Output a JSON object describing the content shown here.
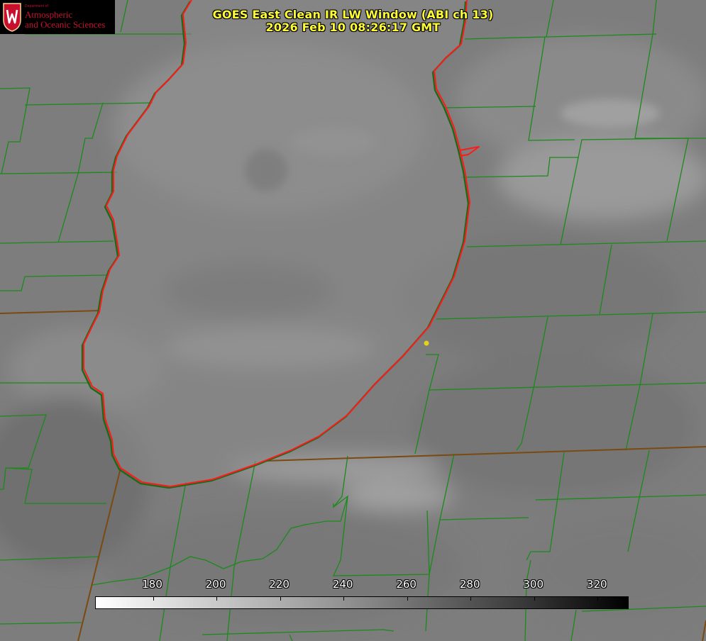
{
  "title": {
    "line1": "GOES East Clean IR LW Window (ABI ch 13)",
    "line2": "2026 Feb 10 08:26:17 GMT"
  },
  "logo": {
    "department": "Department of",
    "line1": "Atmospheric",
    "line2": "and Oceanic Sciences",
    "crest_letter": "W"
  },
  "colorbar": {
    "labels": [
      "180",
      "200",
      "220",
      "240",
      "260",
      "280",
      "300",
      "320"
    ],
    "range": [
      162,
      330
    ]
  },
  "colors": {
    "title": "#ffff33",
    "county_lines": "#1a8a1a",
    "state_lines": "#7a4a10",
    "coastline": "#ff1a1a",
    "marker": "#e6d21a",
    "logo_text": "#c8102e"
  }
}
